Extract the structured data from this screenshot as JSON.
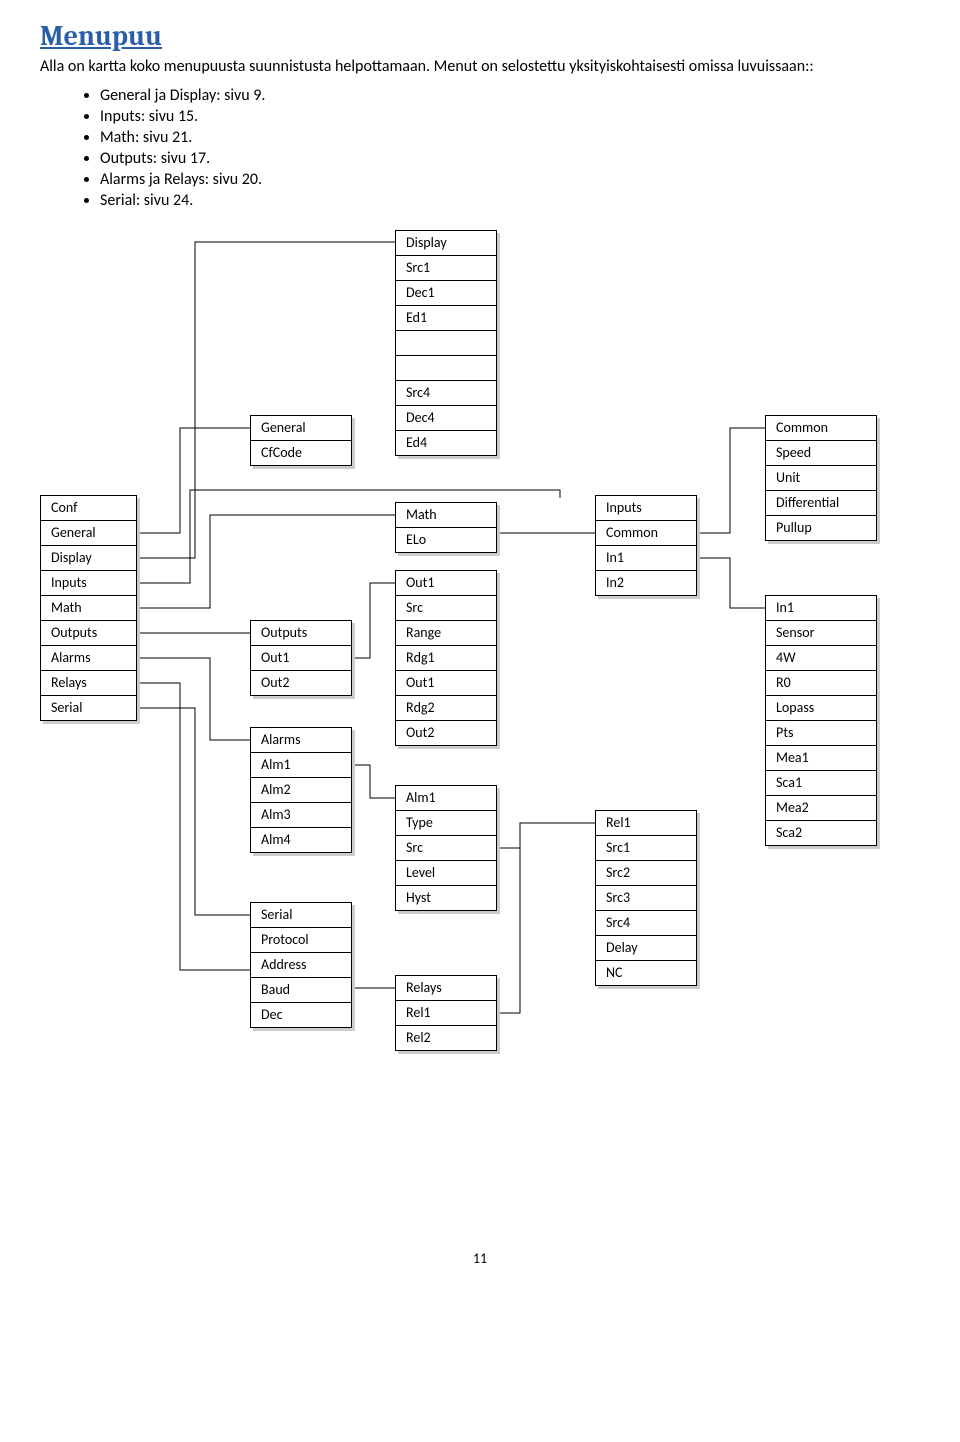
{
  "heading": "Menupuu",
  "intro": "Alla on kartta koko menupuusta suunnistusta helpottamaan. Menut on selostettu yksityiskohtaisesti omissa luvuissaan::",
  "bullets": [
    "General ja Display: sivu 9.",
    "Inputs: sivu 15.",
    "Math: sivu 21.",
    "Outputs: sivu 17.",
    "Alarms ja Relays: sivu 20.",
    "Serial: sivu 24."
  ],
  "page_number": "11",
  "chart_data": {
    "type": "tree",
    "boxes": {
      "display": {
        "title": "Display",
        "items": [
          "Src1",
          "Dec1",
          "Ed1",
          "",
          "",
          "Src4",
          "Dec4",
          "Ed4"
        ]
      },
      "general": {
        "title": "General",
        "items": [
          "CfCode"
        ]
      },
      "conf": {
        "title": "Conf",
        "items": [
          "General",
          "Display",
          "Inputs",
          "Math",
          "Outputs",
          "Alarms",
          "Relays",
          "Serial"
        ]
      },
      "outputs": {
        "title": "Outputs",
        "items": [
          "Out1",
          "Out2"
        ]
      },
      "alarms": {
        "title": "Alarms",
        "items": [
          "Alm1",
          "Alm2",
          "Alm3",
          "Alm4"
        ]
      },
      "serial": {
        "title": "Serial",
        "items": [
          "Protocol",
          "Address",
          "Baud",
          "Dec"
        ]
      },
      "math": {
        "title": "Math",
        "items": [
          "ELo"
        ]
      },
      "out1": {
        "title": "Out1",
        "items": [
          "Src",
          "Range",
          "Rdg1",
          "Out1",
          "Rdg2",
          "Out2"
        ]
      },
      "alm1": {
        "title": "Alm1",
        "items": [
          "Type",
          "Src",
          "Level",
          "Hyst"
        ]
      },
      "relays": {
        "title": "Relays",
        "items": [
          "Rel1",
          "Rel2"
        ]
      },
      "inputs": {
        "title": "Inputs",
        "items": [
          "Common",
          "In1",
          "In2"
        ]
      },
      "rel1": {
        "title": "Rel1",
        "items": [
          "Src1",
          "Src2",
          "Src3",
          "Src4",
          "Delay",
          "NC"
        ]
      },
      "common": {
        "title": "Common",
        "items": [
          "Speed",
          "Unit",
          "Differential",
          "Pullup"
        ]
      },
      "in1": {
        "title": "In1",
        "items": [
          "Sensor",
          "4W",
          "R0",
          "Lopass",
          "Pts",
          "Mea1",
          "Sca1",
          "Mea2",
          "Sca2"
        ]
      }
    },
    "edges": [
      [
        "conf.General",
        "general"
      ],
      [
        "conf.Display",
        "display"
      ],
      [
        "conf.Inputs",
        "inputs"
      ],
      [
        "conf.Math",
        "math"
      ],
      [
        "conf.Outputs",
        "outputs"
      ],
      [
        "conf.Alarms",
        "alarms"
      ],
      [
        "conf.Relays",
        "relays"
      ],
      [
        "conf.Serial",
        "serial"
      ],
      [
        "outputs.Out1",
        "out1"
      ],
      [
        "alarms.Alm1",
        "alm1"
      ],
      [
        "math.ELo",
        "inputs"
      ],
      [
        "inputs.Common",
        "common"
      ],
      [
        "inputs.In1",
        "in1"
      ],
      [
        "relays.Rel1",
        "rel1"
      ],
      [
        "alm1",
        "rel1"
      ]
    ]
  }
}
